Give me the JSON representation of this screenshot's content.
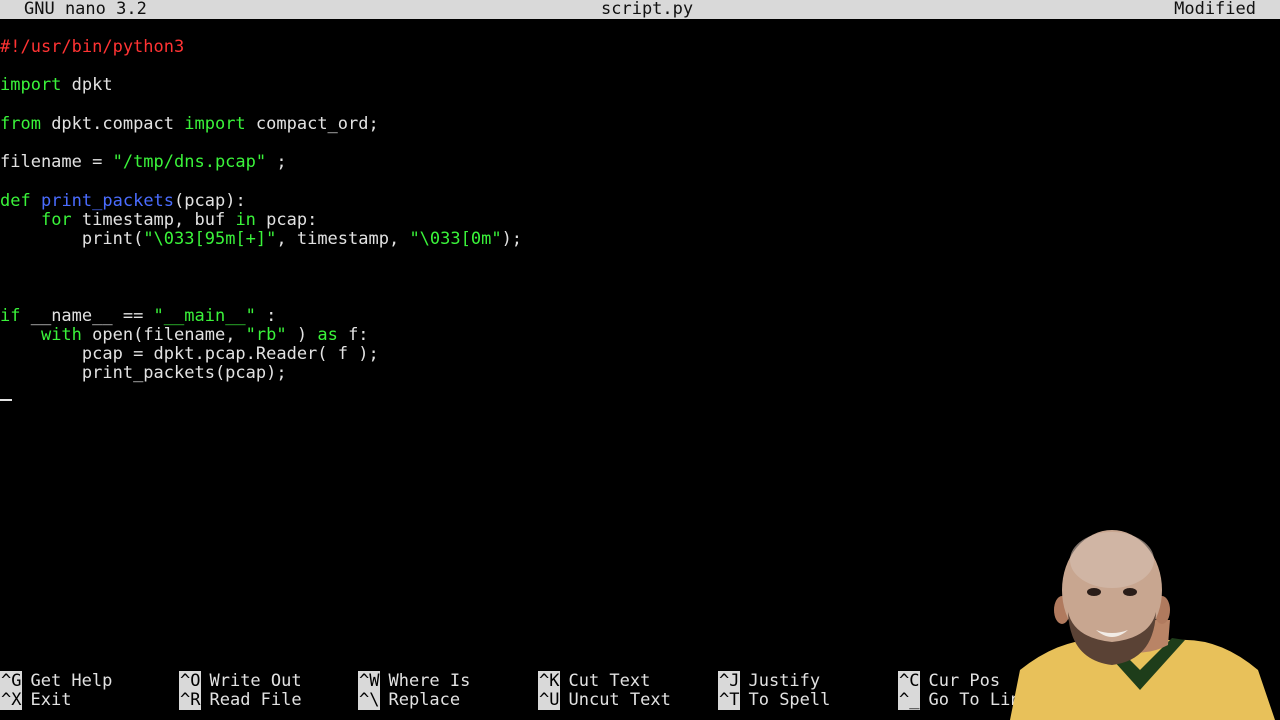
{
  "titlebar": {
    "app": "GNU nano 3.2",
    "filename": "script.py",
    "status": "Modified"
  },
  "code": {
    "l1": "#!/usr/bin/python3",
    "l3_kw": "import",
    "l3_rest": " dpkt",
    "l5_kw1": "from",
    "l5_mid": " dpkt.compact ",
    "l5_kw2": "import",
    "l5_rest": " compact_ord;",
    "l7_a": "filename = ",
    "l7_str": "\"/tmp/dns.pcap\"",
    "l7_b": " ;",
    "l9_kw": "def",
    "l9_fn": "print_packets",
    "l9_rest": "(pcap):",
    "l10_kw": "for",
    "l10_mid": " timestamp, buf ",
    "l10_kw2": "in",
    "l10_rest": " pcap:",
    "l11_a": "print(",
    "l11_str1": "\"\\033[95m[+]\"",
    "l11_b": ", timestamp, ",
    "l11_str2": "\"\\033[0m\"",
    "l11_c": ");",
    "l15_kw": "if",
    "l15_a": " __name__ == ",
    "l15_str": "\"__main__\"",
    "l15_b": " :",
    "l16_kw": "with",
    "l16_a": " open(filename, ",
    "l16_str": "\"rb\"",
    "l16_b": " ) ",
    "l16_kw2": "as",
    "l16_c": " f:",
    "l17": "pcap = dpkt.pcap.Reader( f );",
    "l18": "print_packets(pcap);"
  },
  "shortcuts": [
    {
      "key": "^G",
      "label": "Get Help"
    },
    {
      "key": "^X",
      "label": "Exit"
    },
    {
      "key": "^O",
      "label": "Write Out"
    },
    {
      "key": "^R",
      "label": "Read File"
    },
    {
      "key": "^W",
      "label": "Where Is"
    },
    {
      "key": "^\\",
      "label": "Replace"
    },
    {
      "key": "^K",
      "label": "Cut Text"
    },
    {
      "key": "^U",
      "label": "Uncut Text"
    },
    {
      "key": "^J",
      "label": "Justify"
    },
    {
      "key": "^T",
      "label": "To Spell"
    },
    {
      "key": "^C",
      "label": "Cur Pos"
    },
    {
      "key": "^_",
      "label": "Go To Line"
    }
  ]
}
